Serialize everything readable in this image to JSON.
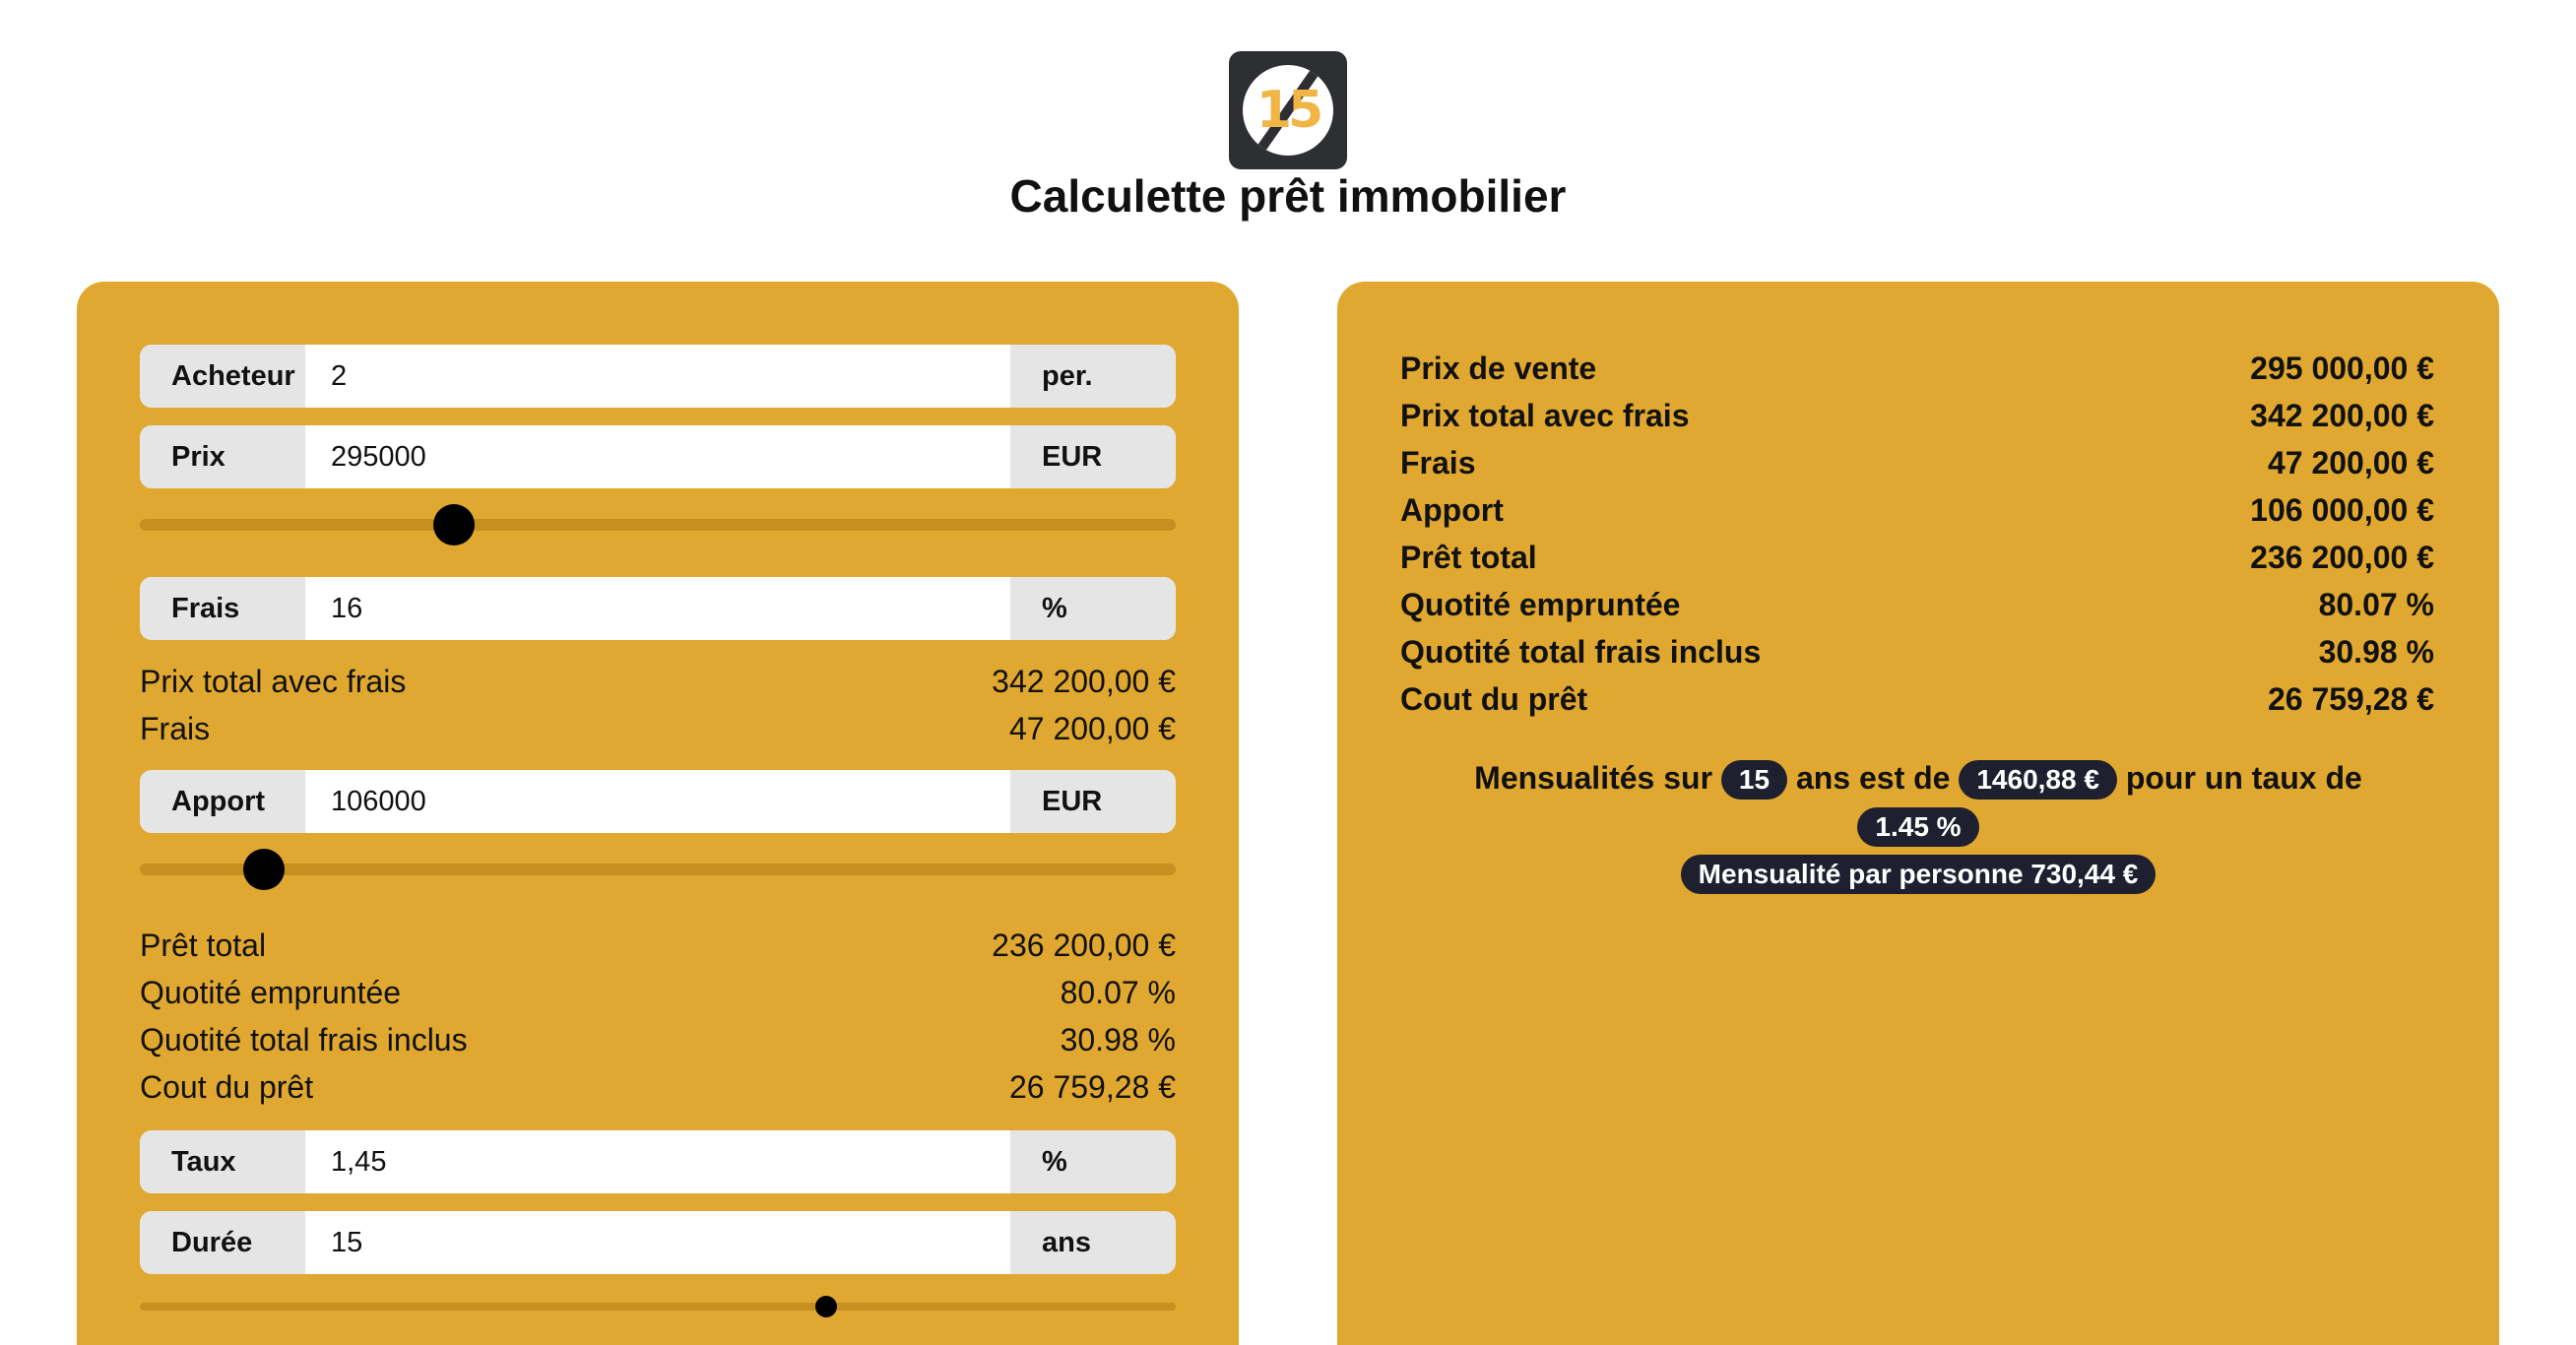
{
  "header": {
    "logo_text": "15",
    "title": "Calculette prêt immobilier"
  },
  "form": {
    "acheteur": {
      "label": "Acheteur",
      "value": "2",
      "unit": "per."
    },
    "prix": {
      "label": "Prix",
      "value": "295000",
      "unit": "EUR",
      "slider_fraction": 0.303
    },
    "frais": {
      "label": "Frais",
      "value": "16",
      "unit": "%"
    },
    "apport": {
      "label": "Apport",
      "value": "106000",
      "unit": "EUR",
      "slider_fraction": 0.12
    },
    "taux": {
      "label": "Taux",
      "value": "1,45",
      "unit": "%"
    },
    "duree": {
      "label": "Durée",
      "value": "15",
      "unit": "ans",
      "slider_fraction": 0.663
    }
  },
  "left_info": {
    "prix_total": {
      "label": "Prix total avec frais",
      "value": "342 200,00 €"
    },
    "frais": {
      "label": "Frais",
      "value": "47 200,00 €"
    },
    "pret_total": {
      "label": "Prêt total",
      "value": "236 200,00 €"
    },
    "quotite": {
      "label": "Quotité empruntée",
      "value": "80.07 %"
    },
    "quotite_frais": {
      "label": "Quotité total frais inclus",
      "value": "30.98 %"
    },
    "cout": {
      "label": "Cout du prêt",
      "value": "26 759,28 €"
    }
  },
  "right_info": {
    "prix_vente": {
      "label": "Prix de vente",
      "value": "295 000,00 €"
    },
    "prix_total": {
      "label": "Prix total avec frais",
      "value": "342 200,00 €"
    },
    "frais": {
      "label": "Frais",
      "value": "47 200,00 €"
    },
    "apport": {
      "label": "Apport",
      "value": "106 000,00 €"
    },
    "pret_total": {
      "label": "Prêt total",
      "value": "236 200,00 €"
    },
    "quotite": {
      "label": "Quotité empruntée",
      "value": "80.07 %"
    },
    "quotite_frais": {
      "label": "Quotité total frais inclus",
      "value": "30.98 %"
    },
    "cout": {
      "label": "Cout du prêt",
      "value": "26 759,28 €"
    }
  },
  "summary": {
    "text_1": "Mensualités sur",
    "years": "15",
    "text_2": "ans est de",
    "monthly": "1460,88 €",
    "text_3": "pour un taux de",
    "rate": "1.45 %",
    "per_person": "Mensualité par personne 730,44 €"
  },
  "colors": {
    "panel": "#e0a830",
    "track": "#c78e20",
    "pill": "#1e2030",
    "logo_bg": "#2d2f33",
    "logo_accent": "#f0b545"
  }
}
